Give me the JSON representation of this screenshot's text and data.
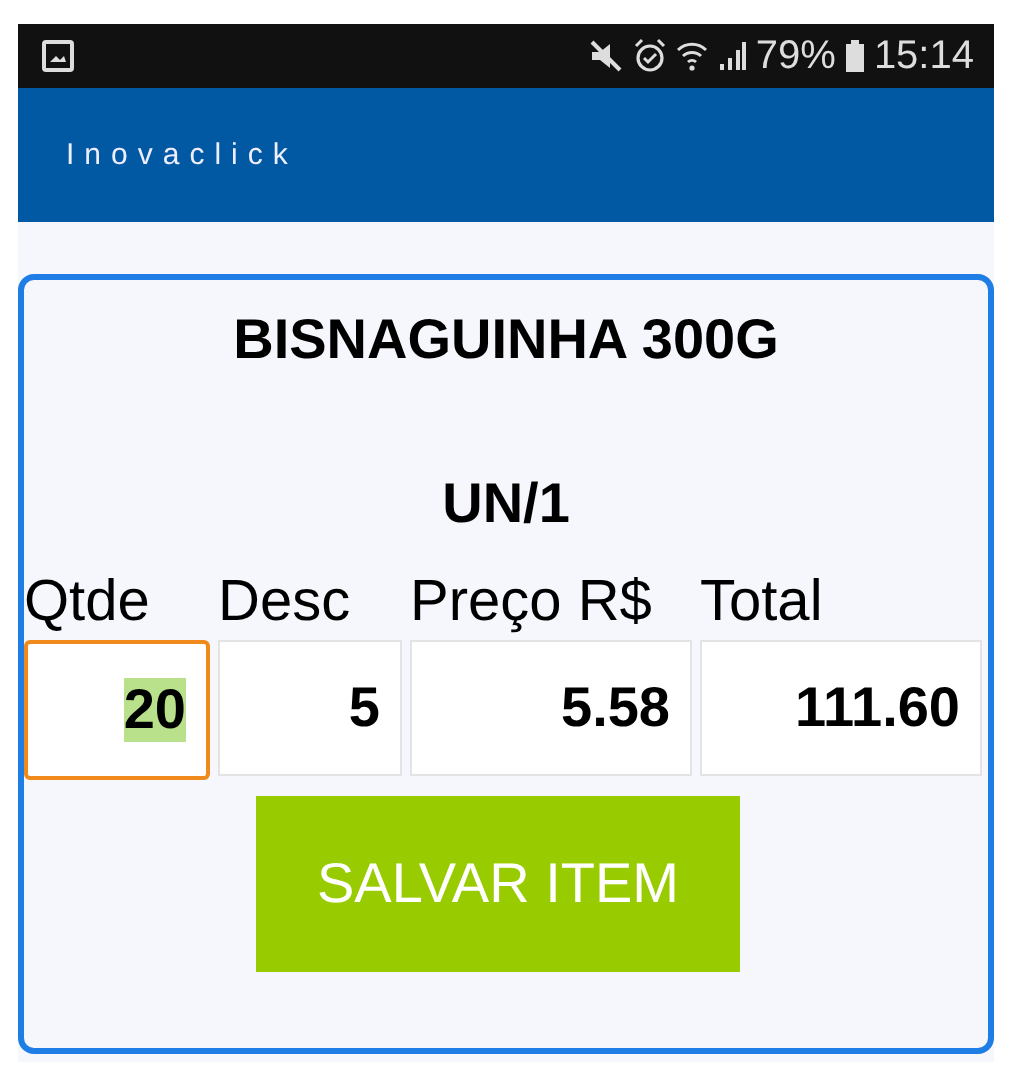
{
  "status_bar": {
    "battery": "79%",
    "time": "15:14"
  },
  "app_bar": {
    "title": "Inovaclick"
  },
  "product": {
    "name": "BISNAGUINHA 300G",
    "unit": "UN/1"
  },
  "fields": [
    {
      "label": "Qtde",
      "value": "20",
      "focused": true,
      "selected": true
    },
    {
      "label": "Desc",
      "value": "5",
      "focused": false,
      "selected": false
    },
    {
      "label": "Preço R$",
      "value": "5.58",
      "focused": false,
      "selected": false
    },
    {
      "label": "Total",
      "value": "111.60",
      "focused": false,
      "selected": false
    }
  ],
  "buttons": [
    "SALVAR ITEM"
  ]
}
